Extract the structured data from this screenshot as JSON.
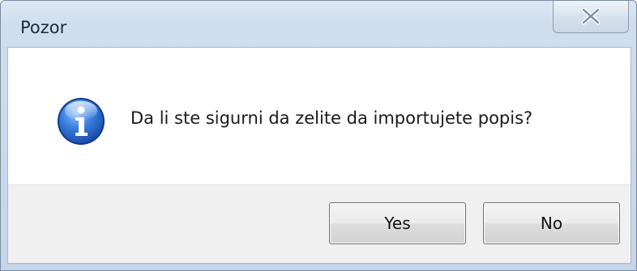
{
  "window": {
    "title": "Pozor"
  },
  "message": {
    "text": "Da li ste sigurni da zelite da importujete popis?",
    "icon": "info-icon"
  },
  "buttons": {
    "yes_label": "Yes",
    "no_label": "No"
  },
  "colors": {
    "titlebar": "#cfdeef",
    "icon_blue": "#2e6fd0",
    "button_area": "#f0f0f0"
  }
}
